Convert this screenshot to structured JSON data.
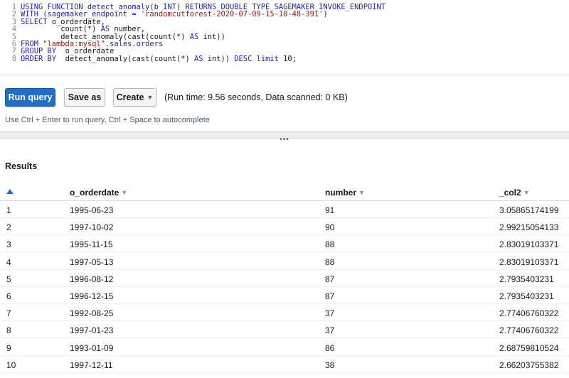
{
  "editor": {
    "lines": [
      {
        "num": "1",
        "segments": [
          {
            "t": "USING FUNCTION detect_anomaly(b INT) RETURNS DOUBLE TYPE SAGEMAKER_INVOKE_ENDPOINT",
            "c": "kw"
          }
        ]
      },
      {
        "num": "2",
        "segments": [
          {
            "t": "WITH (sagemaker_endpoint = ",
            "c": "kw"
          },
          {
            "t": "'randomcutforest-2020-07-09-15-10-48-391'",
            "c": "str"
          },
          {
            "t": ")",
            "c": "kw"
          }
        ]
      },
      {
        "num": "3",
        "segments": [
          {
            "t": "SELECT ",
            "c": "kw"
          },
          {
            "t": "o_orderdate,",
            "c": "plain"
          }
        ]
      },
      {
        "num": "4",
        "segments": [
          {
            "t": "         count(*) ",
            "c": "plain"
          },
          {
            "t": "AS",
            "c": "kw"
          },
          {
            "t": " number,",
            "c": "plain"
          }
        ]
      },
      {
        "num": "5",
        "segments": [
          {
            "t": "         detect_anomaly(cast(count(*) ",
            "c": "plain"
          },
          {
            "t": "AS",
            "c": "kw"
          },
          {
            "t": " int))",
            "c": "plain"
          }
        ]
      },
      {
        "num": "6",
        "segments": [
          {
            "t": "FROM ",
            "c": "kw"
          },
          {
            "t": "\"lambda:mysql\"",
            "c": "str"
          },
          {
            "t": ".sales.orders",
            "c": "kw"
          }
        ]
      },
      {
        "num": "7",
        "segments": [
          {
            "t": "GROUP BY  ",
            "c": "kw"
          },
          {
            "t": "o_orderdate",
            "c": "plain"
          }
        ]
      },
      {
        "num": "8",
        "segments": [
          {
            "t": "ORDER BY  ",
            "c": "kw"
          },
          {
            "t": "detect_anomaly(cast(count(*) ",
            "c": "plain"
          },
          {
            "t": "AS",
            "c": "kw"
          },
          {
            "t": " int)) ",
            "c": "plain"
          },
          {
            "t": "DESC limit",
            "c": "kw"
          },
          {
            "t": " 10;",
            "c": "plain"
          }
        ]
      }
    ]
  },
  "toolbar": {
    "run_label": "Run query",
    "save_label": "Save as",
    "create_label": "Create",
    "status": "(Run time: 9.56 seconds, Data scanned: 0 KB)"
  },
  "hint": "Use Ctrl + Enter to run query, Ctrl + Space to autocomplete",
  "splitter_glyph": "•••",
  "results": {
    "title": "Results",
    "columns": [
      "o_orderdate",
      "number",
      "_col2"
    ],
    "sort_glyph": "▼",
    "rows": [
      {
        "idx": "1",
        "date": "1995-06-23",
        "num": "91",
        "col2": "3.05865174199"
      },
      {
        "idx": "2",
        "date": "1997-10-02",
        "num": "90",
        "col2": "2.99215054133"
      },
      {
        "idx": "3",
        "date": "1995-11-15",
        "num": "88",
        "col2": "2.83019103371"
      },
      {
        "idx": "4",
        "date": "1997-05-13",
        "num": "88",
        "col2": "2.83019103371"
      },
      {
        "idx": "5",
        "date": "1996-08-12",
        "num": "87",
        "col2": "2.7935403231"
      },
      {
        "idx": "6",
        "date": "1996-12-15",
        "num": "87",
        "col2": "2.7935403231"
      },
      {
        "idx": "7",
        "date": "1992-08-25",
        "num": "37",
        "col2": "2.77406760322"
      },
      {
        "idx": "8",
        "date": "1997-01-23",
        "num": "37",
        "col2": "2.77406760322"
      },
      {
        "idx": "9",
        "date": "1993-01-09",
        "num": "86",
        "col2": "2.68759810524"
      },
      {
        "idx": "10",
        "date": "1997-12-11",
        "num": "38",
        "col2": "2.66203755382"
      }
    ]
  }
}
